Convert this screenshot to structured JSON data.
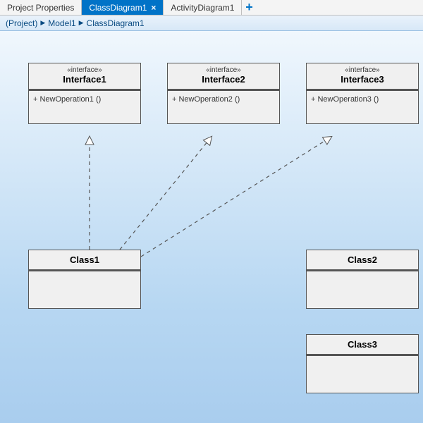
{
  "tabs": {
    "project_properties": "Project Properties",
    "class_diagram": "ClassDiagram1",
    "activity_diagram": "ActivityDiagram1"
  },
  "breadcrumb": {
    "project": "(Project)",
    "model": "Model1",
    "diagram": "ClassDiagram1"
  },
  "interfaces": [
    {
      "stereotype": "«interface»",
      "name": "Interface1",
      "operation": "+ NewOperation1 ()"
    },
    {
      "stereotype": "«interface»",
      "name": "Interface2",
      "operation": "+ NewOperation2 ()"
    },
    {
      "stereotype": "«interface»",
      "name": "Interface3",
      "operation": "+ NewOperation3 ()"
    }
  ],
  "classes": [
    {
      "name": "Class1"
    },
    {
      "name": "Class2"
    },
    {
      "name": "Class3"
    }
  ]
}
